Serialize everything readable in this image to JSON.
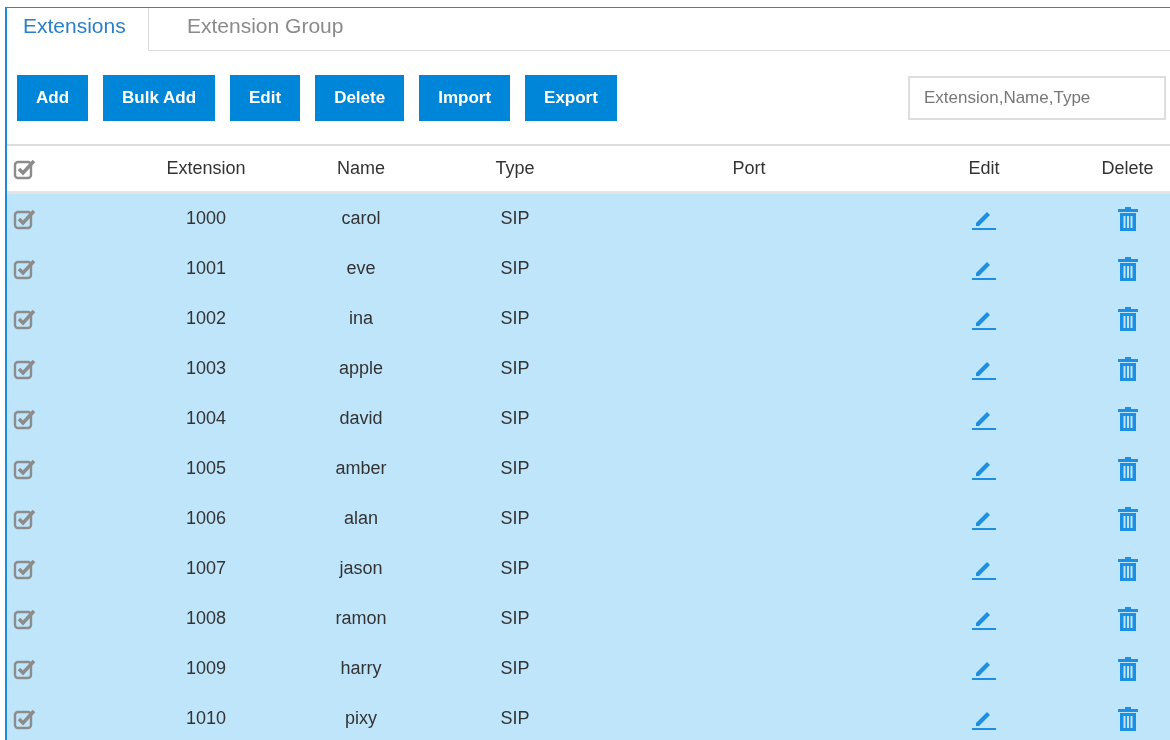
{
  "tabs": [
    {
      "label": "Extensions",
      "selected": true
    },
    {
      "label": "Extension Group",
      "selected": false
    }
  ],
  "toolbar": {
    "buttons": [
      "Add",
      "Bulk Add",
      "Edit",
      "Delete",
      "Import",
      "Export"
    ]
  },
  "search": {
    "placeholder": "Extension,Name,Type"
  },
  "table": {
    "all_checked": true,
    "columns": [
      "Extension",
      "Name",
      "Type",
      "Port",
      "Edit",
      "Delete"
    ],
    "rows": [
      {
        "extension": "1000",
        "name": "carol",
        "type": "SIP",
        "selected": true
      },
      {
        "extension": "1001",
        "name": "eve",
        "type": "SIP",
        "selected": true
      },
      {
        "extension": "1002",
        "name": "ina",
        "type": "SIP",
        "selected": true
      },
      {
        "extension": "1003",
        "name": "apple",
        "type": "SIP",
        "selected": true
      },
      {
        "extension": "1004",
        "name": "david",
        "type": "SIP",
        "selected": true
      },
      {
        "extension": "1005",
        "name": "amber",
        "type": "SIP",
        "selected": true
      },
      {
        "extension": "1006",
        "name": "alan",
        "type": "SIP",
        "selected": true
      },
      {
        "extension": "1007",
        "name": "jason",
        "type": "SIP",
        "selected": true
      },
      {
        "extension": "1008",
        "name": "ramon",
        "type": "SIP",
        "selected": true
      },
      {
        "extension": "1009",
        "name": "harry",
        "type": "SIP",
        "selected": true
      },
      {
        "extension": "1010",
        "name": "pixy",
        "type": "SIP",
        "selected": true
      }
    ]
  }
}
